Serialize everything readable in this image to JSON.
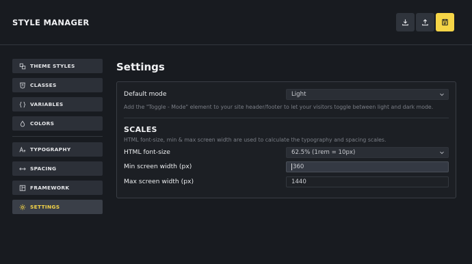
{
  "app": {
    "title": "STYLE MANAGER"
  },
  "header": {
    "buttons": [
      {
        "icon": "download-icon"
      },
      {
        "icon": "upload-icon"
      },
      {
        "icon": "save-icon"
      }
    ]
  },
  "sidebar": {
    "groups": [
      [
        {
          "label": "THEME STYLES",
          "icon": "theme-styles-icon"
        },
        {
          "label": "CLASSES",
          "icon": "classes-icon"
        },
        {
          "label": "VARIABLES",
          "icon": "braces-icon"
        },
        {
          "label": "COLORS",
          "icon": "droplet-icon"
        }
      ],
      [
        {
          "label": "TYPOGRAPHY",
          "icon": "typography-icon"
        },
        {
          "label": "SPACING",
          "icon": "spacing-icon"
        },
        {
          "label": "FRAMEWORK",
          "icon": "framework-icon"
        },
        {
          "label": "SETTINGS",
          "icon": "gear-icon",
          "active": true
        }
      ]
    ],
    "accent": "#f5d547"
  },
  "main": {
    "title": "Settings",
    "default_mode": {
      "label": "Default mode",
      "value": "Light",
      "help": "Add the \"Toggle - Mode\" element to your site header/footer to let your visitors toggle between light and dark mode."
    },
    "scales": {
      "title": "SCALES",
      "help": "HTML font-size, min & max screen width are used to calculate the typography and spacing scales.",
      "font_size": {
        "label": "HTML font-size",
        "value": "62.5% (1rem = 10px)"
      },
      "min_width": {
        "label": "Min screen width (px)",
        "value": "360"
      },
      "max_width": {
        "label": "Max screen width (px)",
        "value": "1440"
      }
    }
  }
}
